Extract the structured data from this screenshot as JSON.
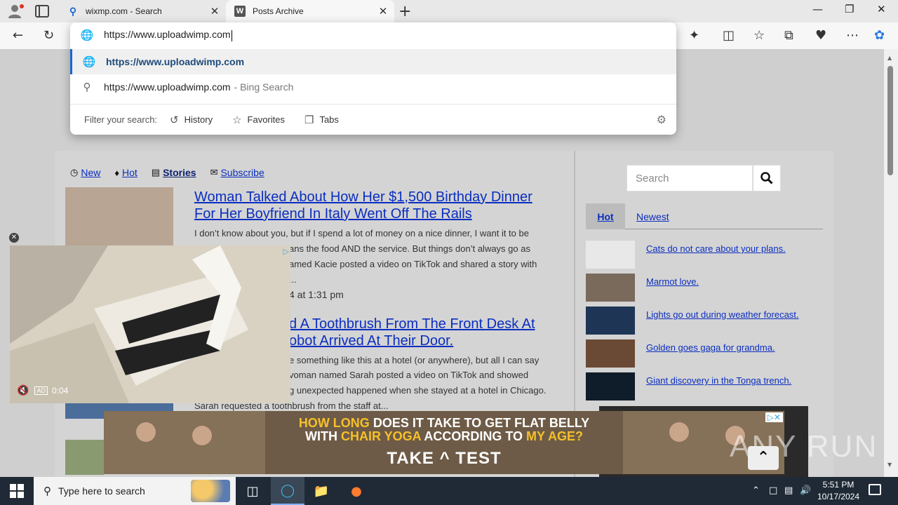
{
  "tabs": [
    {
      "favicon": "Q",
      "title": "wixmp.com - Search"
    },
    {
      "favicon": "W",
      "title": "Posts Archive"
    }
  ],
  "omnibox": {
    "input": "https://www.uploadwimp.com",
    "suggestion_selected": "https://www.uploadwimp.com",
    "suggestion_bing": "https://www.uploadwimp.com",
    "suggestion_bing_suffix": "- Bing Search",
    "filter_label": "Filter your search:",
    "filters": [
      "History",
      "Favorites",
      "Tabs"
    ]
  },
  "site_nav": [
    {
      "icon": "clock-icon",
      "label": "New"
    },
    {
      "icon": "fire-icon",
      "label": "Hot"
    },
    {
      "icon": "newspaper-icon",
      "label": "Stories"
    },
    {
      "icon": "envelope-icon",
      "label": "Subscribe"
    }
  ],
  "posts": [
    {
      "title_l1": "Woman Talked About How Her $1,500 Birthday Dinner",
      "title_l2": "For Her Boyfriend In Italy Went Off The Rails",
      "line1": "I don’t know about you, but if I spend a lot of money on a nice dinner, I want it to be",
      "line2": "ans the food AND the service. But things don’t always go as",
      "line3": "amed Kacie posted a video on TikTok and shared a story with",
      "line4": "...",
      "date": "4 at 1:31 pm"
    },
    {
      "title_l1": "d A Toothbrush From The Front Desk At",
      "title_l2": "obot Arrived At Their Door.",
      "line1": "e something like this at a hotel (or anywhere), but all I can say",
      "line2": "voman named Sarah posted a video on TikTok and showed",
      "line3": "g unexpected happened when she stayed at a hotel in Chicago.",
      "line4": "Sarah requested a toothbrush from the staff at..."
    }
  ],
  "sidebar": {
    "search_placeholder": "Search",
    "tabs": [
      "Hot",
      "Newest"
    ],
    "items": [
      "Cats do not care about your plans.",
      "Marmot love.",
      "Lights go out during weather forecast.",
      "Golden goes gaga for grandma.",
      "Giant discovery in the Tonga trench."
    ]
  },
  "video_ad": {
    "ad_tag": "AD",
    "time": "0:04"
  },
  "banner_ad": {
    "line1_a": "HOW LONG",
    "line1_b": "DOES IT TAKE TO GET FLAT BELLY",
    "line2_a": "WITH",
    "line2_b": "CHAIR YOGA",
    "line2_c": "ACCORDING TO",
    "line2_d": "MY AGE?",
    "cta": "TAKE ^ TEST"
  },
  "watermark": "ANY RUN",
  "taskbar": {
    "search_placeholder": "Type here to search",
    "time": "5:51 PM",
    "date": "10/17/2024"
  }
}
